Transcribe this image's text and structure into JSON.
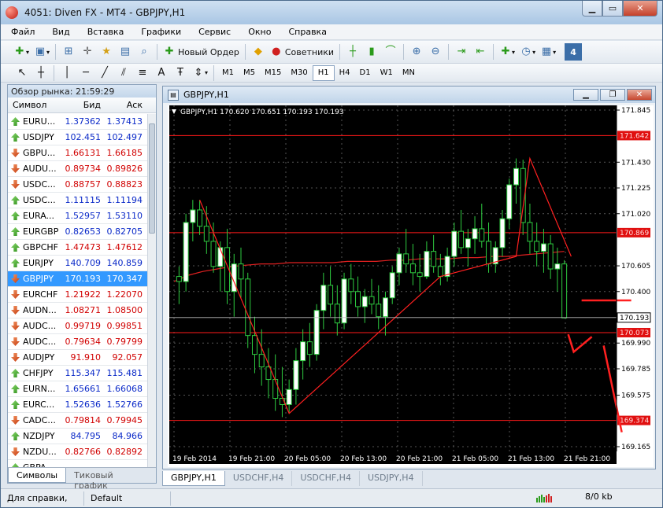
{
  "window": {
    "title": "4051: Diven FX - MT4 - GBPJPY,H1"
  },
  "menu": [
    "Файл",
    "Вид",
    "Вставка",
    "Графики",
    "Сервис",
    "Окно",
    "Справка"
  ],
  "toolbar": {
    "new_order": "Новый Ордер",
    "advisors": "Советники"
  },
  "timeframes": [
    "M1",
    "M5",
    "M15",
    "M30",
    "H1",
    "H4",
    "D1",
    "W1",
    "MN"
  ],
  "active_timeframe": "H1",
  "market_watch": {
    "title": "Обзор рынка: 21:59:29",
    "headers": {
      "symbol": "Символ",
      "bid": "Бид",
      "ask": "Аск"
    },
    "rows": [
      {
        "symbol": "EURU...",
        "bid": "1.37362",
        "ask": "1.37413",
        "dir": "up",
        "color": "blue"
      },
      {
        "symbol": "USDJPY",
        "bid": "102.451",
        "ask": "102.497",
        "dir": "up",
        "color": "blue"
      },
      {
        "symbol": "GBPU...",
        "bid": "1.66131",
        "ask": "1.66185",
        "dir": "down",
        "color": "red"
      },
      {
        "symbol": "AUDU...",
        "bid": "0.89734",
        "ask": "0.89826",
        "dir": "down",
        "color": "red"
      },
      {
        "symbol": "USDC...",
        "bid": "0.88757",
        "ask": "0.88823",
        "dir": "down",
        "color": "red"
      },
      {
        "symbol": "USDC...",
        "bid": "1.11115",
        "ask": "1.11194",
        "dir": "up",
        "color": "blue"
      },
      {
        "symbol": "EURA...",
        "bid": "1.52957",
        "ask": "1.53110",
        "dir": "up",
        "color": "blue"
      },
      {
        "symbol": "EURGBP",
        "bid": "0.82653",
        "ask": "0.82705",
        "dir": "up",
        "color": "blue"
      },
      {
        "symbol": "GBPCHF",
        "bid": "1.47473",
        "ask": "1.47612",
        "dir": "up",
        "color": "red"
      },
      {
        "symbol": "EURJPY",
        "bid": "140.709",
        "ask": "140.859",
        "dir": "up",
        "color": "blue"
      },
      {
        "symbol": "GBPJPY",
        "bid": "170.193",
        "ask": "170.347",
        "dir": "down",
        "color": "white",
        "selected": true
      },
      {
        "symbol": "EURCHF",
        "bid": "1.21922",
        "ask": "1.22070",
        "dir": "down",
        "color": "red"
      },
      {
        "symbol": "AUDN...",
        "bid": "1.08271",
        "ask": "1.08500",
        "dir": "down",
        "color": "red"
      },
      {
        "symbol": "AUDC...",
        "bid": "0.99719",
        "ask": "0.99851",
        "dir": "down",
        "color": "red"
      },
      {
        "symbol": "AUDC...",
        "bid": "0.79634",
        "ask": "0.79799",
        "dir": "down",
        "color": "red"
      },
      {
        "symbol": "AUDJPY",
        "bid": "91.910",
        "ask": "92.057",
        "dir": "down",
        "color": "red"
      },
      {
        "symbol": "CHFJPY",
        "bid": "115.347",
        "ask": "115.481",
        "dir": "up",
        "color": "blue"
      },
      {
        "symbol": "EURN...",
        "bid": "1.65661",
        "ask": "1.66068",
        "dir": "up",
        "color": "blue"
      },
      {
        "symbol": "EURC...",
        "bid": "1.52636",
        "ask": "1.52766",
        "dir": "up",
        "color": "blue"
      },
      {
        "symbol": "CADC...",
        "bid": "0.79814",
        "ask": "0.79945",
        "dir": "down",
        "color": "red"
      },
      {
        "symbol": "NZDJPY",
        "bid": "84.795",
        "ask": "84.966",
        "dir": "up",
        "color": "blue"
      },
      {
        "symbol": "NZDU...",
        "bid": "0.82766",
        "ask": "0.82892",
        "dir": "down",
        "color": "red"
      },
      {
        "symbol": "GBPA",
        "bid": "",
        "ask": "",
        "dir": "up",
        "color": "blue"
      }
    ],
    "tabs": [
      "Символы",
      "Тиковый график"
    ]
  },
  "chart_window": {
    "title": "GBPJPY,H1"
  },
  "chart_data": {
    "type": "candlestick",
    "title": "GBPJPY,H1  170.620 170.651 170.193 170.193",
    "background": "#000000",
    "up_color": "#ffffff",
    "down_color": "#000000",
    "wick_color": "#2ecc40",
    "price_axis": {
      "range": [
        169.165,
        171.845
      ],
      "ticks": [
        "171.845",
        "171.430",
        "171.225",
        "171.020",
        "170.605",
        "170.400",
        "169.990",
        "169.785",
        "169.575",
        "169.165"
      ]
    },
    "time_axis": {
      "labels": [
        "19 Feb 2014",
        "19 Feb 21:00",
        "20 Feb 05:00",
        "20 Feb 13:00",
        "20 Feb 21:00",
        "21 Feb 05:00",
        "21 Feb 13:00",
        "21 Feb 21:00"
      ]
    },
    "current_price": 170.193,
    "horizontal_lines": [
      {
        "price": 171.642,
        "label": "171.642"
      },
      {
        "price": 170.869,
        "label": "170.869"
      },
      {
        "price": 170.073,
        "label": "170.073"
      },
      {
        "price": 169.374,
        "label": "169.374"
      }
    ],
    "moving_average": [
      170.48,
      170.53,
      170.56,
      170.58,
      170.6,
      170.61,
      170.62,
      170.62,
      170.63,
      170.63,
      170.63,
      170.63,
      170.64,
      170.64,
      170.64,
      170.65,
      170.65,
      170.66,
      170.66,
      170.66,
      170.67,
      170.67,
      170.68,
      170.68,
      170.69,
      170.7,
      170.71,
      170.72
    ],
    "zigzag": [
      {
        "i": 3,
        "price": 171.13
      },
      {
        "i": 16,
        "price": 169.43
      },
      {
        "i": 38,
        "price": 170.52
      },
      {
        "i": 49,
        "price": 170.68
      },
      {
        "i": 51,
        "price": 171.46
      },
      {
        "i": 57,
        "price": 170.68
      }
    ],
    "candles": [
      [
        170.52,
        170.6,
        170.3,
        170.48
      ],
      [
        170.48,
        171.02,
        170.4,
        170.95
      ],
      [
        170.95,
        171.13,
        170.8,
        171.05
      ],
      [
        171.05,
        171.13,
        170.85,
        170.92
      ],
      [
        170.92,
        171.08,
        170.7,
        170.8
      ],
      [
        170.8,
        170.95,
        170.55,
        170.6
      ],
      [
        170.6,
        170.8,
        170.4,
        170.75
      ],
      [
        170.75,
        170.9,
        170.3,
        170.4
      ],
      [
        170.4,
        170.7,
        170.2,
        170.62
      ],
      [
        170.62,
        170.75,
        170.35,
        170.5
      ],
      [
        170.5,
        170.55,
        169.95,
        170.05
      ],
      [
        170.05,
        170.2,
        169.75,
        169.9
      ],
      [
        169.9,
        170.1,
        169.65,
        169.8
      ],
      [
        169.8,
        169.95,
        169.55,
        169.7
      ],
      [
        169.7,
        169.9,
        169.45,
        169.55
      ],
      [
        169.55,
        169.8,
        169.4,
        169.5
      ],
      [
        169.5,
        169.7,
        169.43,
        169.62
      ],
      [
        169.62,
        169.95,
        169.5,
        169.85
      ],
      [
        169.85,
        170.1,
        169.7,
        170.0
      ],
      [
        170.0,
        170.15,
        169.8,
        169.9
      ],
      [
        169.9,
        170.3,
        169.85,
        170.25
      ],
      [
        170.25,
        170.55,
        170.1,
        170.45
      ],
      [
        170.45,
        170.6,
        170.2,
        170.3
      ],
      [
        170.3,
        170.45,
        170.05,
        170.15
      ],
      [
        170.15,
        170.55,
        170.1,
        170.5
      ],
      [
        170.5,
        170.62,
        170.3,
        170.4
      ],
      [
        170.4,
        170.52,
        170.2,
        170.28
      ],
      [
        170.28,
        170.42,
        170.15,
        170.36
      ],
      [
        170.36,
        170.5,
        170.22,
        170.3
      ],
      [
        170.3,
        170.45,
        170.1,
        170.2
      ],
      [
        170.2,
        170.4,
        170.05,
        170.35
      ],
      [
        170.35,
        170.6,
        170.3,
        170.55
      ],
      [
        170.55,
        170.75,
        170.45,
        170.7
      ],
      [
        170.7,
        170.9,
        170.55,
        170.62
      ],
      [
        170.62,
        170.78,
        170.45,
        170.55
      ],
      [
        170.55,
        170.7,
        170.4,
        170.52
      ],
      [
        170.52,
        170.8,
        170.5,
        170.72
      ],
      [
        170.72,
        170.85,
        170.55,
        170.6
      ],
      [
        170.6,
        170.7,
        170.45,
        170.52
      ],
      [
        170.52,
        170.75,
        170.48,
        170.68
      ],
      [
        170.68,
        170.95,
        170.6,
        170.88
      ],
      [
        170.88,
        171.05,
        170.7,
        170.75
      ],
      [
        170.75,
        170.9,
        170.6,
        170.82
      ],
      [
        170.82,
        171.0,
        170.7,
        170.9
      ],
      [
        170.9,
        171.1,
        170.75,
        170.8
      ],
      [
        170.8,
        170.95,
        170.55,
        170.62
      ],
      [
        170.62,
        170.8,
        170.55,
        170.75
      ],
      [
        170.75,
        171.05,
        170.68,
        170.98
      ],
      [
        170.98,
        171.3,
        170.9,
        171.25
      ],
      [
        171.25,
        171.46,
        171.1,
        171.38
      ],
      [
        171.38,
        171.45,
        170.85,
        170.95
      ],
      [
        170.95,
        171.1,
        170.7,
        170.8
      ],
      [
        170.8,
        170.95,
        170.6,
        170.72
      ],
      [
        170.72,
        170.9,
        170.55,
        170.78
      ],
      [
        170.78,
        170.85,
        170.5,
        170.58
      ],
      [
        170.58,
        170.75,
        170.4,
        170.62
      ],
      [
        170.62,
        170.65,
        170.19,
        170.19
      ]
    ]
  },
  "chart_tabs": [
    "GBPJPY,H1",
    "USDCHF,H4",
    "USDCHF,H4",
    "USDJPY,H4"
  ],
  "status": {
    "help": "Для справки, наж",
    "profile": "Default",
    "traffic": "8/0 kb"
  }
}
